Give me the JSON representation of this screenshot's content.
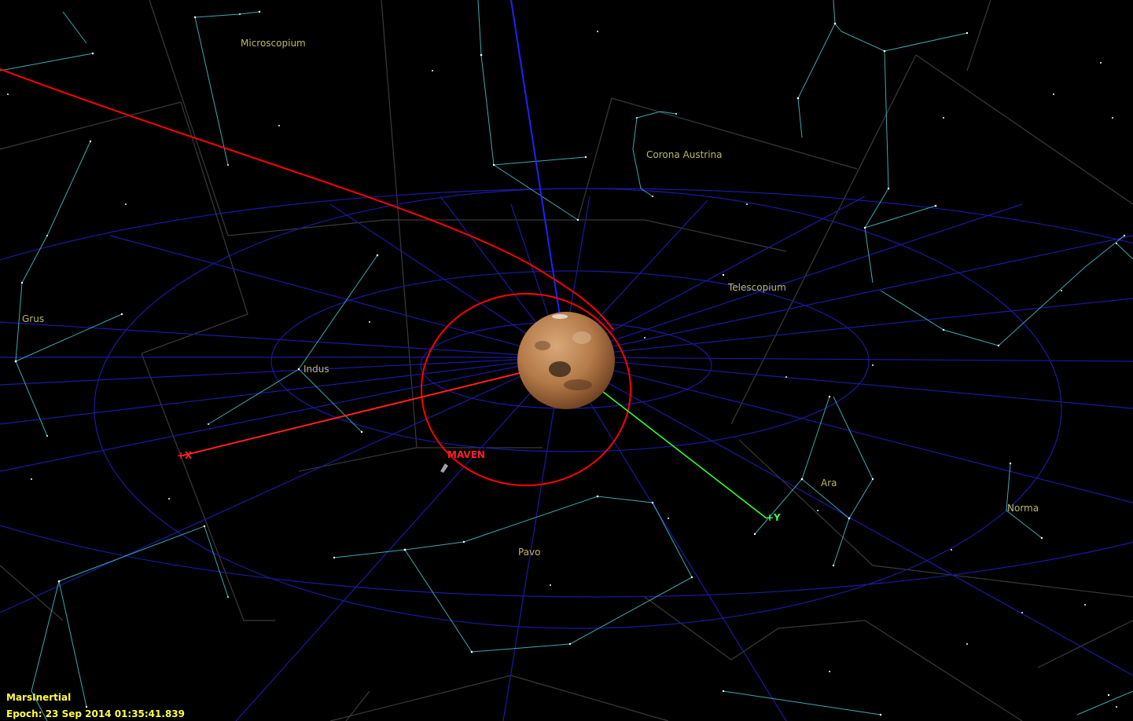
{
  "view": {
    "coordinate_system": "MarsInertial",
    "epoch_label": "Epoch:",
    "epoch_value": "23 Sep 2014 01:35:41.839"
  },
  "constellations": [
    "Microscopium",
    "Corona Austrina",
    "Telescopium",
    "Grus",
    "Indus",
    "Ara",
    "Norma",
    "Pavo"
  ],
  "objects": {
    "spacecraft": "MAVEN",
    "body": "Mars"
  },
  "axes": {
    "x_label": "+X",
    "y_label": "+Y"
  },
  "colors": {
    "background": "#000000",
    "constellation_lines": "#3fa7b0",
    "constellation_boundaries": "#3a3a3a",
    "constellation_labels": "#bdb76b",
    "grid": "#1a1aa0",
    "orbit": "#ff0000",
    "x_axis": "#ff2020",
    "y_axis": "#30ff30",
    "z_axis": "#2020ff",
    "hud_text": "#ffff40"
  }
}
